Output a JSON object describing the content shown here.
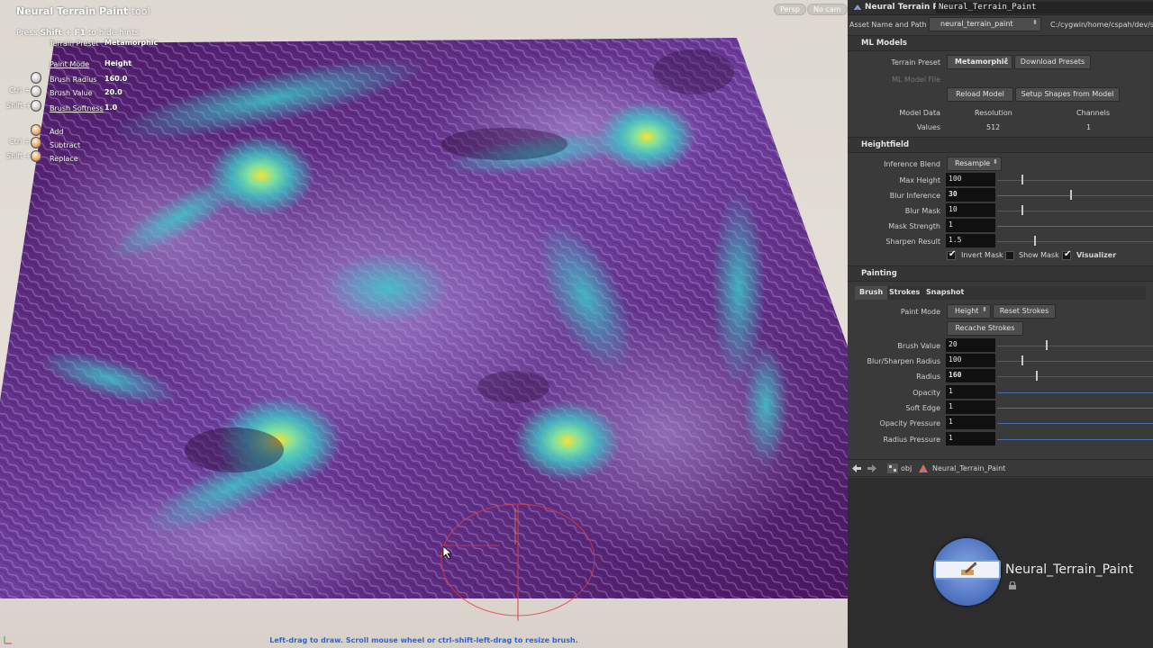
{
  "viewport": {
    "tool_title_bold": "Neural Terrain Paint",
    "tool_title_rest": " tool",
    "hint_prefix": "Press ",
    "hint_keys": "Shift + F1",
    "hint_suffix": " to hide hints",
    "persp_button": "Persp",
    "cam_button": "No cam",
    "hud": {
      "terrain_preset_label": "Terrain Preset",
      "terrain_preset_value": "Metamorphic",
      "paint_mode_label": "Paint Mode",
      "paint_mode_value": "Height",
      "brush_radius_label": "Brush Radius",
      "brush_radius_value": "160.0",
      "brush_value_label": "Brush Value",
      "brush_value_value": "20.0",
      "brush_softness_label": "Brush Softness",
      "brush_softness_value": "1.0",
      "ctrl_key": "Ctrl",
      "shift_key": "Shift",
      "add_label": "Add",
      "subtract_label": "Subtract",
      "replace_label": "Replace"
    },
    "status_line": "Left-drag to draw. Scroll mouse wheel or ctrl-shift-left-drag to resize brush."
  },
  "panel": {
    "node_type": "Neural Terrain Paint",
    "node_name": "Neural_Terrain_Paint",
    "asset_label": "Asset Name and Path",
    "asset_name": "neural_terrain_paint",
    "asset_path": "C:/cygwin/home/cspah/dev/src",
    "ml_models": {
      "title": "ML Models",
      "terrain_preset_label": "Terrain Preset",
      "terrain_preset_value": "Metamorphic",
      "download_presets": "Download Presets",
      "ml_model_file_label": "ML Model File",
      "reload_model": "Reload Model",
      "setup_shapes": "Setup Shapes from Model",
      "model_data_label": "Model Data",
      "resolution_label": "Resolution",
      "channels_label": "Channels",
      "values_label": "Values",
      "resolution_value": "512",
      "channels_value": "1"
    },
    "heightfield": {
      "title": "Heightfield",
      "inference_blend_label": "Inference Blend",
      "inference_blend_value": "Resample",
      "max_height_label": "Max Height",
      "max_height_value": "100",
      "blur_inference_label": "Blur Inference",
      "blur_inference_value": "30",
      "blur_mask_label": "Blur Mask",
      "blur_mask_value": "10",
      "mask_strength_label": "Mask Strength",
      "mask_strength_value": "1",
      "sharpen_result_label": "Sharpen Result",
      "sharpen_result_value": "1.5",
      "invert_mask": "Invert Mask",
      "show_mask": "Show Mask",
      "visualizer": "Visualizer",
      "invert_mask_checked": true,
      "show_mask_checked": false,
      "visualizer_checked": true
    },
    "painting": {
      "title": "Painting",
      "tabs": [
        "Brush",
        "Strokes",
        "Snapshot"
      ],
      "paint_mode_label": "Paint Mode",
      "paint_mode_value": "Height",
      "reset_strokes": "Reset Strokes",
      "recache_strokes": "Recache Strokes",
      "brush_value_label": "Brush Value",
      "brush_value_value": "20",
      "blur_sharpen_radius_label": "Blur/Sharpen Radius",
      "blur_sharpen_radius_value": "100",
      "radius_label": "Radius",
      "radius_value": "160",
      "opacity_label": "Opacity",
      "opacity_value": "1",
      "soft_edge_label": "Soft Edge",
      "soft_edge_value": "1",
      "opacity_pressure_label": "Opacity Pressure",
      "opacity_pressure_value": "1",
      "radius_pressure_label": "Radius Pressure",
      "radius_pressure_value": "1"
    },
    "path": {
      "obj": "obj",
      "node": "Neural_Terrain_Paint"
    },
    "network": {
      "node_label": "Neural_Terrain_Paint"
    }
  },
  "colors": {
    "terrain_base": "#5a1a6e",
    "ridge_cyan": "#3cc6c8",
    "peak_yellow": "#f2e23a",
    "brush_circle": "#e04040",
    "status_blue": "#3563c9",
    "slider_blue": "#4a6fa5"
  },
  "icons": [
    "back-arrow-icon",
    "forward-arrow-icon",
    "obj-context-icon",
    "node-type-icon",
    "lock-icon",
    "mouse-icon",
    "axis-gizmo-icon",
    "cursor-arrow-icon"
  ]
}
